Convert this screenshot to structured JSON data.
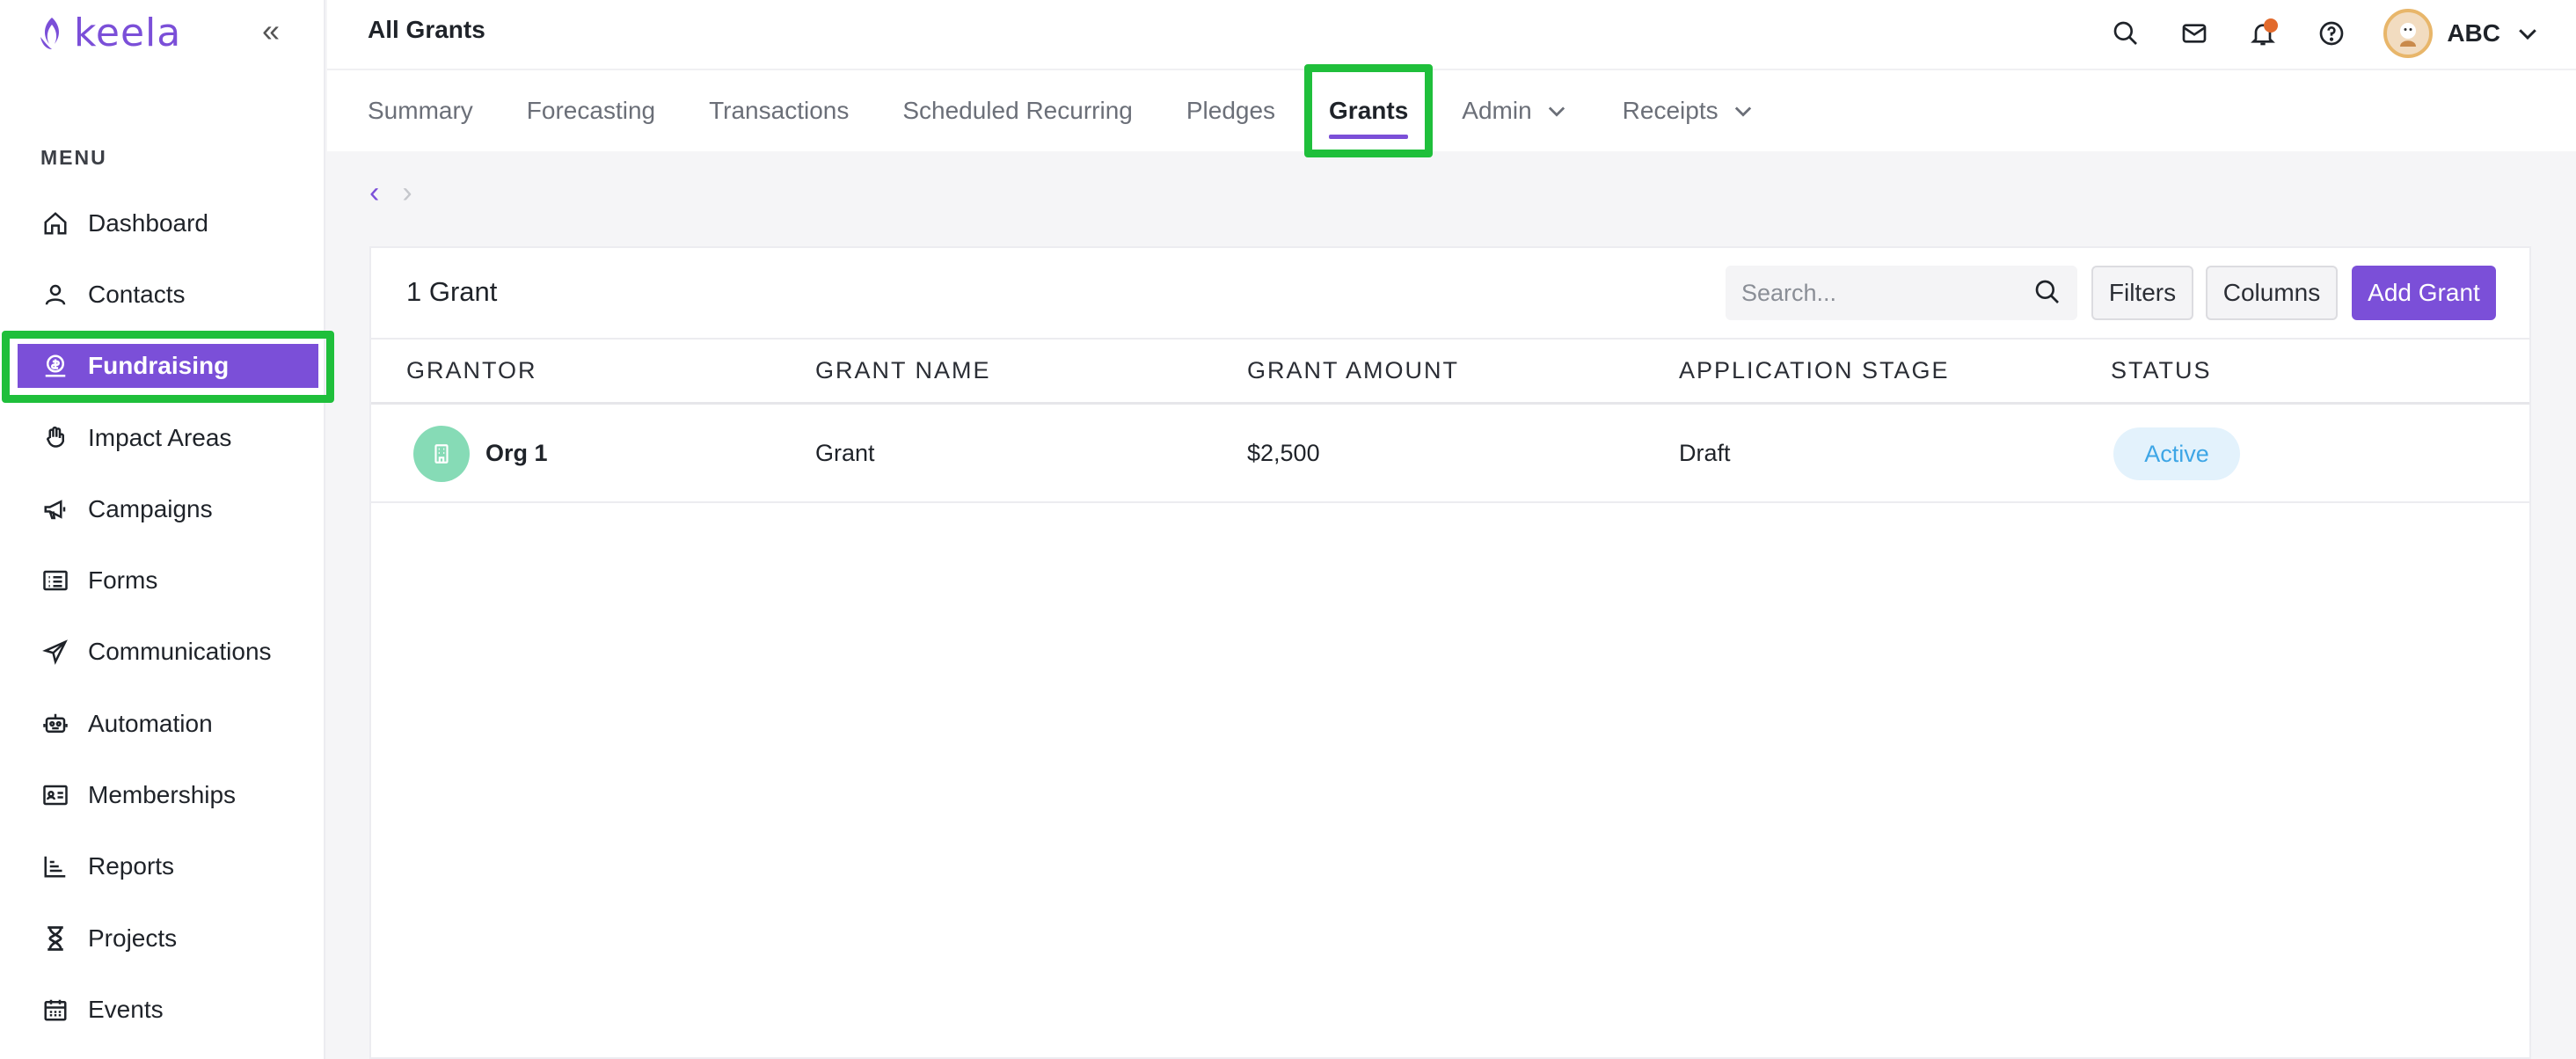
{
  "app": {
    "logo_text": "keela",
    "collapse_glyph": "«"
  },
  "sidebar": {
    "menu_title": "MENU",
    "items": [
      {
        "label": "Dashboard",
        "icon": "home-icon"
      },
      {
        "label": "Contacts",
        "icon": "user-icon"
      },
      {
        "label": "Fundraising",
        "icon": "donation-icon",
        "active": true
      },
      {
        "label": "Impact Areas",
        "icon": "hand-icon"
      },
      {
        "label": "Campaigns",
        "icon": "megaphone-icon"
      },
      {
        "label": "Forms",
        "icon": "form-icon"
      },
      {
        "label": "Communications",
        "icon": "paper-plane-icon"
      },
      {
        "label": "Automation",
        "icon": "robot-icon"
      },
      {
        "label": "Memberships",
        "icon": "id-card-icon"
      },
      {
        "label": "Reports",
        "icon": "bar-chart-icon"
      },
      {
        "label": "Projects",
        "icon": "hourglass-icon"
      },
      {
        "label": "Events",
        "icon": "calendar-icon"
      }
    ]
  },
  "header": {
    "title": "All Grants",
    "user_name": "ABC",
    "icons": [
      "search-icon",
      "mail-icon",
      "bell-icon",
      "help-icon"
    ]
  },
  "tabs": {
    "summary": "Summary",
    "forecasting": "Forecasting",
    "transactions": "Transactions",
    "scheduled_recurring": "Scheduled Recurring",
    "pledges": "Pledges",
    "grants": "Grants",
    "admin": "Admin",
    "receipts": "Receipts",
    "active": "Grants"
  },
  "pager": {
    "prev": "‹",
    "next": "›"
  },
  "grants": {
    "count_label": "1 Grant",
    "search_placeholder": "Search...",
    "filters_label": "Filters",
    "columns_label": "Columns",
    "add_label": "Add Grant",
    "headers": {
      "grantor": "GRANTOR",
      "grant_name": "GRANT NAME",
      "grant_amount": "GRANT AMOUNT",
      "application_stage": "APPLICATION STAGE",
      "status": "STATUS"
    },
    "rows": [
      {
        "grantor": "Org 1",
        "grant_name": "Grant",
        "grant_amount": "$2,500",
        "application_stage": "Draft",
        "status": "Active"
      }
    ]
  },
  "colors": {
    "accent": "#7b4fd8",
    "highlight": "#1fbf3b",
    "status_active_text": "#3ea6e6",
    "status_active_bg": "#e3f2fc",
    "notification": "#e26a2c"
  }
}
